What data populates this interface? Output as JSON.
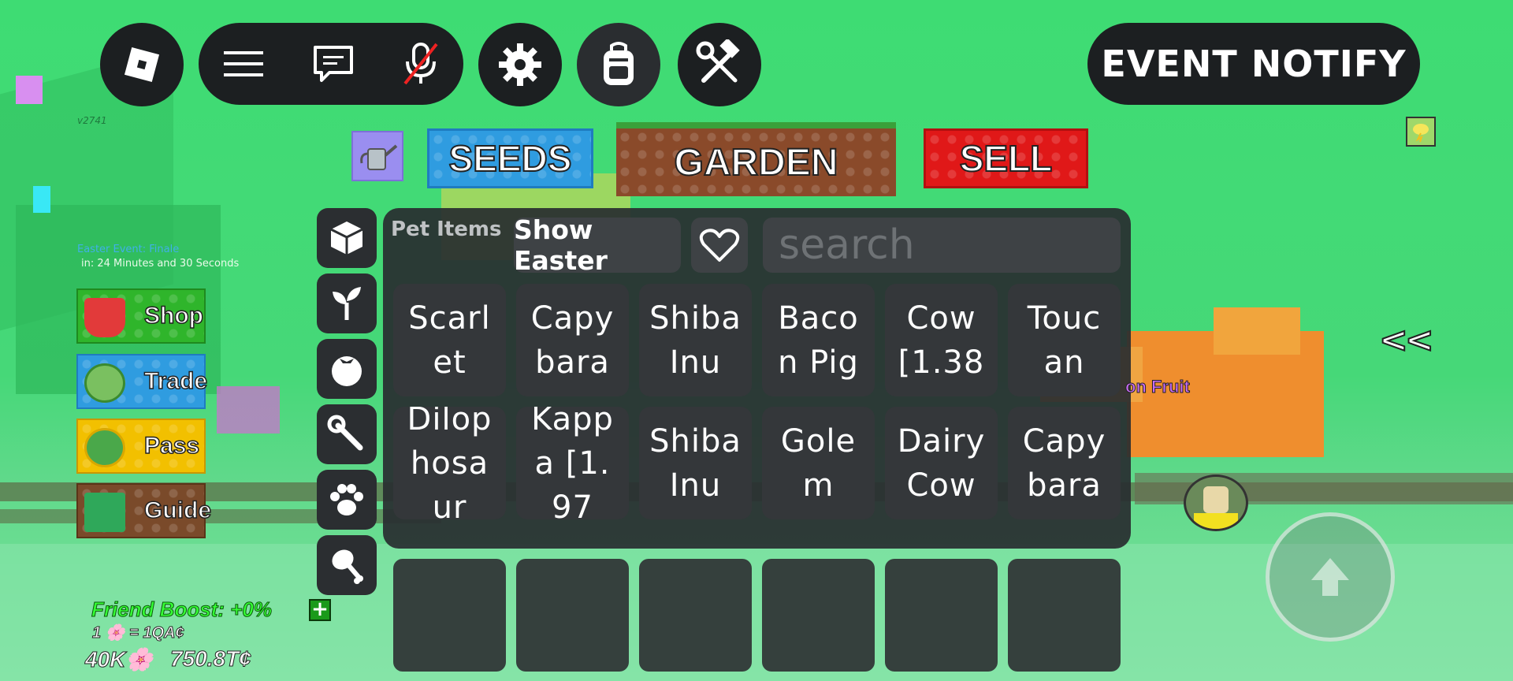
{
  "top_bar": {
    "event_notify_label": "EVENT NOTIFY"
  },
  "tabs": {
    "seeds": "SEEDS",
    "garden": "GARDEN",
    "sell": "SELL"
  },
  "version": "v2741",
  "event": {
    "title": "Easter Event: Finale",
    "countdown": "in: 24 Minutes and 30 Seconds"
  },
  "left_menu": [
    {
      "label": "Shop",
      "color": "#2fb52b"
    },
    {
      "label": "Trade",
      "color": "#2f9ce0"
    },
    {
      "label": "Pass",
      "color": "#f2c000"
    },
    {
      "label": "Guide",
      "color": "#7a4a2a"
    }
  ],
  "inventory": {
    "title": "Pet Items",
    "filter_label": "Show Easter",
    "search_placeholder": "search",
    "categories": [
      "box-icon",
      "sprout-icon",
      "tomato-icon",
      "wrench-icon",
      "paw-icon",
      "drumstick-icon"
    ],
    "items": [
      "Scarlet",
      "Capybara",
      "Shiba Inu",
      "Bacon Pig",
      "Cow [1.38",
      "Toucan",
      "Dilophosaur",
      "Kappa [1.97",
      "Shiba Inu",
      "Golem",
      "Dairy Cow",
      "Capybara"
    ]
  },
  "hotbar_slots": 6,
  "world_label": "on Fruit",
  "collapse_label": "<<",
  "hud": {
    "friend_boost": "Friend Boost: +0%",
    "rate": "1 🌸 = 1QA¢",
    "blossoms": "40K🌸",
    "money": "750.8T¢"
  },
  "colors": {
    "panel_bg": "#2a2e31",
    "seeds": "#2f9ce0",
    "garden": "#8a4a2a",
    "sell": "#e01818",
    "friend_boost": "#35ff35"
  }
}
